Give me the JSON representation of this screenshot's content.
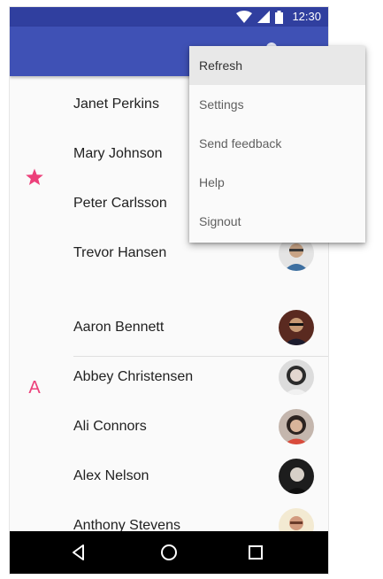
{
  "status_bar": {
    "time": "12:30",
    "icons": [
      "wifi-icon",
      "signal-icon",
      "battery-icon"
    ]
  },
  "overflow_menu": {
    "items": [
      {
        "label": "Refresh",
        "highlighted": true
      },
      {
        "label": "Settings"
      },
      {
        "label": "Send feedback"
      },
      {
        "label": "Help"
      },
      {
        "label": "Signout"
      }
    ]
  },
  "contacts": {
    "favorites_marker": "star-icon",
    "section_letter": "A",
    "favorites": [
      {
        "name": "Janet Perkins"
      },
      {
        "name": "Mary Johnson"
      },
      {
        "name": "Peter Carlsson"
      },
      {
        "name": "Trevor Hansen"
      }
    ],
    "a_section": [
      {
        "name": "Aaron Bennett"
      },
      {
        "name": "Abbey Christensen"
      },
      {
        "name": "Ali Connors"
      },
      {
        "name": "Alex Nelson"
      },
      {
        "name": "Anthony Stevens"
      }
    ]
  },
  "navigation_bar": {
    "buttons": [
      "back-icon",
      "home-icon",
      "recents-icon"
    ]
  },
  "colors": {
    "status_bar": "#303f9f",
    "app_bar": "#3f51b5",
    "accent": "#ec407a"
  }
}
